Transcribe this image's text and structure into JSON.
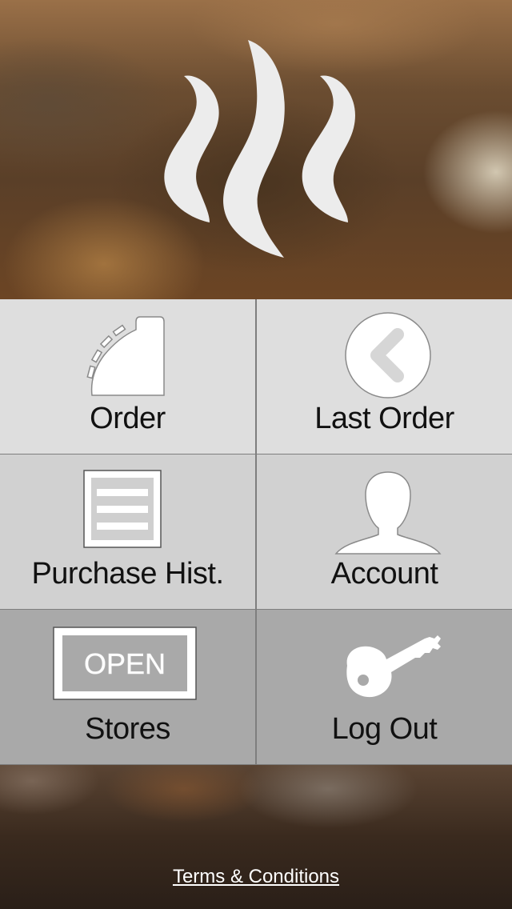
{
  "menu": {
    "order": {
      "label": "Order",
      "icon": "cash-register-icon"
    },
    "last_order": {
      "label": "Last Order",
      "icon": "back-arrow-circle-icon"
    },
    "purchase_history": {
      "label": "Purchase Hist.",
      "icon": "receipt-list-icon"
    },
    "account": {
      "label": "Account",
      "icon": "person-silhouette-icon"
    },
    "stores": {
      "label": "Stores",
      "icon": "open-sign-icon",
      "sign_text": "OPEN"
    },
    "log_out": {
      "label": "Log Out",
      "icon": "key-icon"
    }
  },
  "footer": {
    "terms_label": "Terms & Conditions"
  },
  "colors": {
    "tile_row1": "#dedede",
    "tile_row2": "#d1d1d1",
    "tile_row3": "#a9a9a9",
    "icon_fill": "#ffffff",
    "logo_fill": "#ececec"
  }
}
